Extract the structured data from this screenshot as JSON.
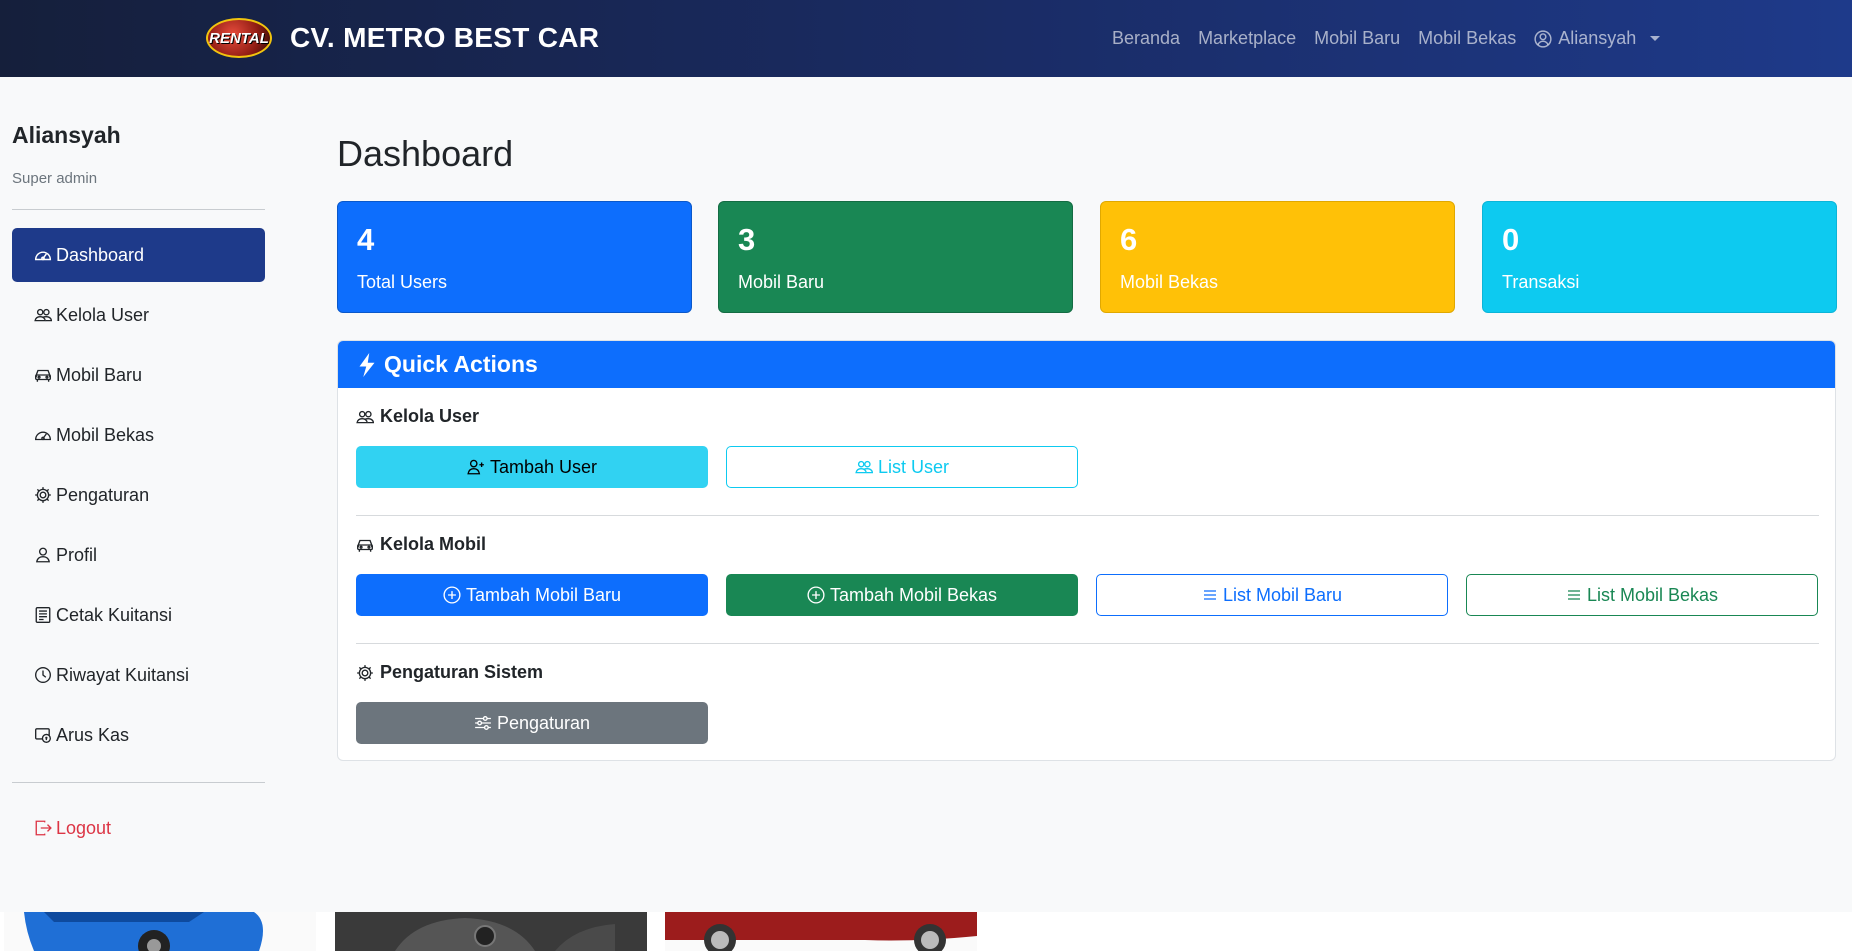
{
  "navbar": {
    "logo_text": "RENTAL",
    "brand": "CV. METRO BEST CAR",
    "links": [
      "Beranda",
      "Marketplace",
      "Mobil Baru",
      "Mobil Bekas"
    ],
    "user": "Aliansyah"
  },
  "sidebar": {
    "user": "Aliansyah",
    "role": "Super admin",
    "items": [
      {
        "label": "Dashboard",
        "icon": "speedometer-icon"
      },
      {
        "label": "Kelola User",
        "icon": "people-icon"
      },
      {
        "label": "Mobil Baru",
        "icon": "car-icon"
      },
      {
        "label": "Mobil Bekas",
        "icon": "speedometer-icon"
      },
      {
        "label": "Pengaturan",
        "icon": "gear-icon"
      },
      {
        "label": "Profil",
        "icon": "person-icon"
      },
      {
        "label": "Cetak Kuitansi",
        "icon": "receipt-icon"
      },
      {
        "label": "Riwayat Kuitansi",
        "icon": "clock-icon"
      },
      {
        "label": "Arus Kas",
        "icon": "cash-icon"
      }
    ],
    "logout": "Logout"
  },
  "main": {
    "title": "Dashboard",
    "stats": [
      {
        "value": "4",
        "label": "Total Users",
        "color": "#0d6efd"
      },
      {
        "value": "3",
        "label": "Mobil Baru",
        "color": "#198754"
      },
      {
        "value": "6",
        "label": "Mobil Bekas",
        "color": "#ffc107"
      },
      {
        "value": "0",
        "label": "Transaksi",
        "color": "#0dcaf0"
      }
    ],
    "quick_actions": {
      "title": "Quick Actions",
      "sections": [
        {
          "title": "Kelola User",
          "buttons": [
            "Tambah User",
            "List User"
          ]
        },
        {
          "title": "Kelola Mobil",
          "buttons": [
            "Tambah Mobil Baru",
            "Tambah Mobil Bekas",
            "List Mobil Baru",
            "List Mobil Bekas"
          ]
        },
        {
          "title": "Pengaturan Sistem",
          "buttons": [
            "Pengaturan"
          ]
        }
      ]
    }
  }
}
